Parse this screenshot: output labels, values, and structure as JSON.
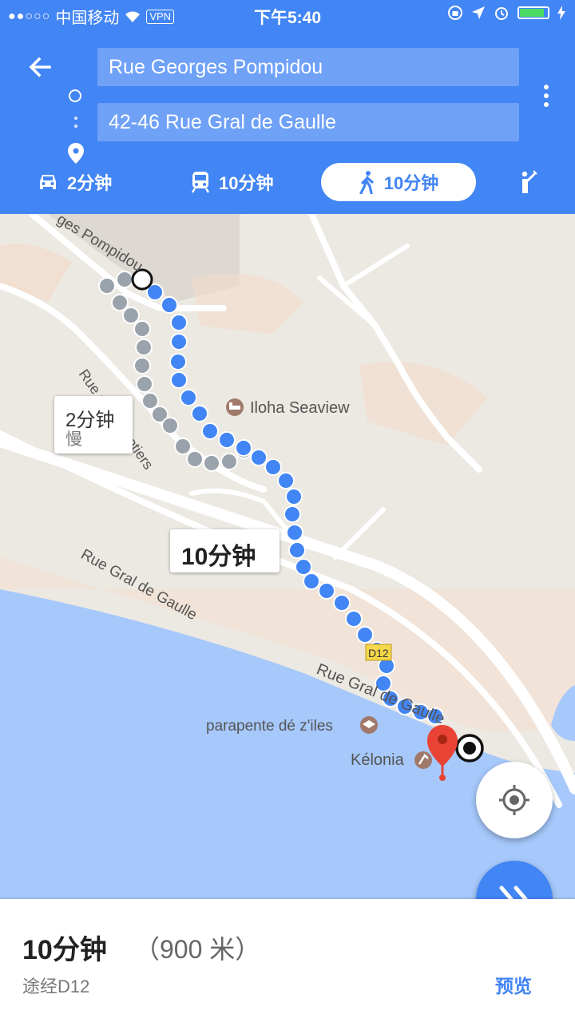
{
  "status_bar": {
    "carrier": "中国移动",
    "vpn": "VPN",
    "time": "下午5:40"
  },
  "header": {
    "origin": "Rue Georges Pompidou",
    "destination": "42-46 Rue Gral de Gaulle"
  },
  "modes": [
    {
      "name": "driving",
      "label": "2分钟"
    },
    {
      "name": "transit",
      "label": "10分钟"
    },
    {
      "name": "walking",
      "label": "10分钟",
      "active": true
    },
    {
      "name": "ride",
      "label": ""
    }
  ],
  "map": {
    "labels": {
      "road_pompidou": "ges Pompidou",
      "road_cocotiers": "Rue des Cocotiers",
      "road_gaulle_1": "Rue Gral de Gaulle",
      "road_gaulle_2": "Rue Gral de Gaulle",
      "road_shield": "D12",
      "poi_hotel": "Iloha Seaview",
      "poi_paraglide": "parapente dé z'iles",
      "poi_kelonia": "Kélonia"
    },
    "bubble_alt": {
      "time": "2分钟",
      "note": "慢"
    },
    "bubble_main": {
      "time": "10分钟"
    }
  },
  "summary": {
    "duration": "10分钟",
    "distance": "（900 米）",
    "via": "途经D12",
    "preview": "预览"
  },
  "colors": {
    "primary": "#4285f4",
    "route_dot": "#4285f4",
    "alt_route_dot": "#9aa3ab",
    "pin_red": "#e94335",
    "sea": "#a6c8fb",
    "land": "#ece8e2"
  }
}
